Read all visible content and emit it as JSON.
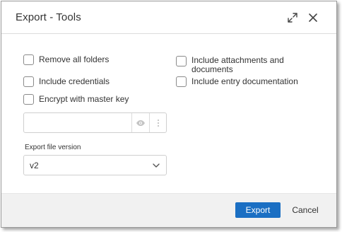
{
  "dialog": {
    "title": "Export - Tools",
    "icons": {
      "expand": "expand-icon",
      "close": "close-icon"
    }
  },
  "options": {
    "remove_all_folders": {
      "label": "Remove all folders",
      "checked": false
    },
    "include_credentials": {
      "label": "Include credentials",
      "checked": false
    },
    "encrypt_with_master_key": {
      "label": "Encrypt with master key",
      "checked": false
    },
    "include_attachments": {
      "label_line1": "Include attachments and",
      "label_line2": "documents",
      "checked": false
    },
    "include_entry_documentation": {
      "label": "Include entry documentation",
      "checked": false
    }
  },
  "password": {
    "value": "",
    "icons": {
      "reveal": "eye-icon",
      "more": "more-vertical-icon"
    }
  },
  "export_version": {
    "label": "Export file version",
    "selected": "v2",
    "icon": "chevron-down-icon"
  },
  "footer": {
    "export_label": "Export",
    "cancel_label": "Cancel"
  },
  "colors": {
    "accent": "#1b6fc3",
    "footer_bg": "#f1f1f1"
  }
}
